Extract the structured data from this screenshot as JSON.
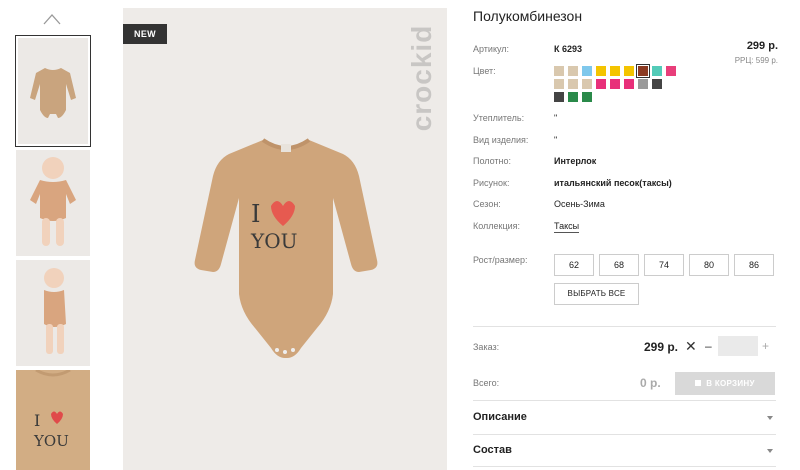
{
  "product": {
    "title": "Полукомбинезон",
    "badge": "NEW",
    "brand": "crockid",
    "print_text_line1": "I",
    "print_text_line2": "YOU"
  },
  "details": {
    "article_label": "Артикул:",
    "article_value": "К 6293",
    "price": "299 р.",
    "rrp": "РРЦ: 599 р.",
    "color_label": "Цвет:",
    "insulation_label": "Утеплитель:",
    "insulation_value": "\"",
    "type_label": "Вид изделия:",
    "type_value": "\"",
    "fabric_label": "Полотно:",
    "fabric_value": "Интерлок",
    "pattern_label": "Рисунок:",
    "pattern_value": "итальянский песок(таксы)",
    "season_label": "Сезон:",
    "season_value": "Осень-Зима",
    "collection_label": "Коллекция:",
    "collection_value": "Таксы"
  },
  "colors": [
    "#d9c8ae",
    "#d9c8ae",
    "#7fc8ec",
    "#f4c400",
    "#f4c400",
    "#f4c400",
    "#8b3a22",
    "#53cbb8",
    "#e83e7a",
    "#d9c8ae",
    "#d9c8ae",
    "#d9c8ae",
    "#e8307a",
    "#e8307a",
    "#e8307a",
    "#9a9a9a",
    "#444444",
    "#444444",
    "#2a8a4a",
    "#2a8a4a"
  ],
  "selected_color_index": 6,
  "sizes": {
    "label": "Рост/размер:",
    "options": [
      "62",
      "68",
      "74",
      "80",
      "86"
    ],
    "select_all": "ВЫБРАТЬ ВСЕ"
  },
  "order": {
    "label": "Заказ:",
    "price": "299 р.",
    "remove_glyph": "✕",
    "minus_glyph": "–",
    "plus_glyph": "+",
    "quantity": ""
  },
  "total": {
    "label": "Всего:",
    "value": "0 р.",
    "cart_button": "В КОРЗИНУ"
  },
  "accordions": {
    "description": "Описание",
    "composition": "Состав"
  }
}
